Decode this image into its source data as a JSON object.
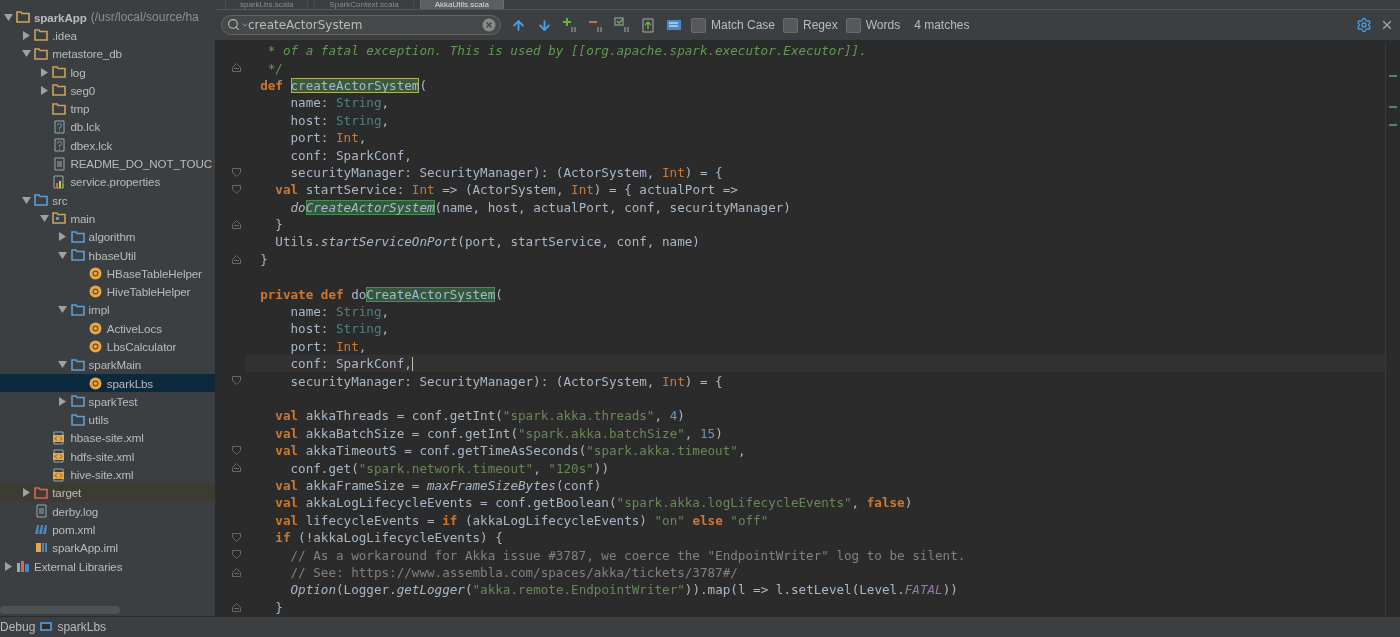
{
  "editor_tabs": [
    {
      "label": "sparkLbs.scala",
      "selected": false
    },
    {
      "label": "SparkContext.scala",
      "selected": false
    },
    {
      "label": "AkkaUtils.scala",
      "selected": true
    }
  ],
  "project_tree": [
    {
      "label": "sparkApp",
      "path": "(/usr/local/source/ha",
      "kind": "module",
      "expanded": true,
      "selected": false,
      "children": [
        {
          "label": ".idea",
          "kind": "folder",
          "expanded": false,
          "selected": false
        },
        {
          "label": "metastore_db",
          "kind": "folder",
          "expanded": true,
          "selected": false,
          "children": [
            {
              "label": "log",
              "kind": "folder",
              "expanded": false,
              "selected": false
            },
            {
              "label": "seg0",
              "kind": "folder",
              "expanded": false,
              "selected": false
            },
            {
              "label": "tmp",
              "kind": "folder",
              "selected": false
            },
            {
              "label": "db.lck",
              "kind": "unknown",
              "selected": false
            },
            {
              "label": "dbex.lck",
              "kind": "unknown",
              "selected": false
            },
            {
              "label": "README_DO_NOT_TOUC",
              "kind": "text",
              "selected": false
            },
            {
              "label": "service.properties",
              "kind": "properties",
              "selected": false
            }
          ]
        },
        {
          "label": "src",
          "kind": "source",
          "expanded": true,
          "selected": false,
          "children": [
            {
              "label": "main",
              "kind": "package",
              "expanded": true,
              "selected": false,
              "children": [
                {
                  "label": "algorithm",
                  "kind": "source",
                  "expanded": false,
                  "selected": false
                },
                {
                  "label": "hbaseUtil",
                  "kind": "source",
                  "expanded": true,
                  "selected": false,
                  "children": [
                    {
                      "label": "HBaseTableHelper",
                      "kind": "object",
                      "selected": false
                    },
                    {
                      "label": "HiveTableHelper",
                      "kind": "object",
                      "selected": false
                    }
                  ]
                },
                {
                  "label": "impl",
                  "kind": "source",
                  "expanded": true,
                  "selected": false,
                  "children": [
                    {
                      "label": "ActiveLocs",
                      "kind": "object",
                      "selected": false
                    },
                    {
                      "label": "LbsCalculator",
                      "kind": "object",
                      "selected": false
                    }
                  ]
                },
                {
                  "label": "sparkMain",
                  "kind": "source",
                  "expanded": true,
                  "selected": false,
                  "children": [
                    {
                      "label": "sparkLbs",
                      "kind": "object",
                      "selected": true
                    }
                  ]
                },
                {
                  "label": "sparkTest",
                  "kind": "source",
                  "expanded": false,
                  "selected": false
                },
                {
                  "label": "utils",
                  "kind": "source",
                  "selected": false
                }
              ]
            },
            {
              "label": "hbase-site.xml",
              "kind": "xml",
              "selected": false
            },
            {
              "label": "hdfs-site.xml",
              "kind": "xml",
              "selected": false
            },
            {
              "label": "hive-site.xml",
              "kind": "xml",
              "selected": false
            }
          ]
        },
        {
          "label": "target",
          "kind": "excluded",
          "expanded": false,
          "selected": false
        },
        {
          "label": "derby.log",
          "kind": "text",
          "selected": false
        },
        {
          "label": "pom.xml",
          "kind": "maven",
          "selected": false
        },
        {
          "label": "sparkApp.iml",
          "kind": "iml",
          "selected": false
        }
      ]
    },
    {
      "label": "External Libraries",
      "kind": "libraries",
      "expanded": false,
      "selected": false
    }
  ],
  "search_bar": {
    "value": "createActorSystem",
    "options": [
      {
        "label": "Match Case",
        "checked": false
      },
      {
        "label": "Regex",
        "checked": false
      },
      {
        "label": "Words",
        "checked": false
      }
    ],
    "result": "4 matches"
  },
  "code_lines": [
    {
      "kind": "plain",
      "current": false,
      "segments": [
        {
          "kind": "doc",
          "t": "   * of a fatal exception. This is used by [[org.apache.spark.executor.Executor]]."
        }
      ]
    },
    {
      "kind": "fold-end",
      "current": false,
      "segments": [
        {
          "kind": "doc",
          "t": "   */"
        }
      ]
    },
    {
      "kind": "plain",
      "current": false,
      "segments": [
        {
          "kind": "kw",
          "t": "  def "
        },
        {
          "kind": "current-match",
          "t": "createActorSystem"
        },
        {
          "kind": "plain",
          "t": "("
        }
      ]
    },
    {
      "kind": "plain",
      "current": false,
      "segments": [
        {
          "kind": "plain",
          "t": "      name: "
        },
        {
          "kind": "type",
          "t": "String"
        },
        {
          "kind": "plain",
          "t": ","
        }
      ]
    },
    {
      "kind": "plain",
      "current": false,
      "segments": [
        {
          "kind": "plain",
          "t": "      host: "
        },
        {
          "kind": "type",
          "t": "String"
        },
        {
          "kind": "plain",
          "t": ","
        }
      ]
    },
    {
      "kind": "plain",
      "current": false,
      "segments": [
        {
          "kind": "plain",
          "t": "      port: "
        },
        {
          "kind": "int",
          "t": "Int"
        },
        {
          "kind": "plain",
          "t": ","
        }
      ]
    },
    {
      "kind": "plain",
      "current": false,
      "segments": [
        {
          "kind": "plain",
          "t": "      conf: SparkConf,"
        }
      ]
    },
    {
      "kind": "fold-start",
      "current": false,
      "segments": [
        {
          "kind": "plain",
          "t": "      securityManager: SecurityManager): (ActorSystem, "
        },
        {
          "kind": "int",
          "t": "Int"
        },
        {
          "kind": "plain",
          "t": ") = {"
        }
      ]
    },
    {
      "kind": "fold-start",
      "current": false,
      "segments": [
        {
          "kind": "kw",
          "t": "    val "
        },
        {
          "kind": "plain",
          "t": "startService: "
        },
        {
          "kind": "int",
          "t": "Int"
        },
        {
          "kind": "plain",
          "t": " => (ActorSystem, "
        },
        {
          "kind": "int",
          "t": "Int"
        },
        {
          "kind": "plain",
          "t": ") = { actualPort =>"
        }
      ]
    },
    {
      "kind": "plain",
      "current": false,
      "segments": [
        {
          "kind": "italic",
          "t": "      do"
        },
        {
          "kind": "match-italic",
          "t": "CreateActorSystem"
        },
        {
          "kind": "plain",
          "t": "(name, host, actualPort, conf, securityManager)"
        }
      ]
    },
    {
      "kind": "fold-end",
      "current": false,
      "segments": [
        {
          "kind": "plain",
          "t": "    }"
        }
      ]
    },
    {
      "kind": "plain",
      "current": false,
      "segments": [
        {
          "kind": "plain",
          "t": "    Utils."
        },
        {
          "kind": "italic",
          "t": "startServiceOnPort"
        },
        {
          "kind": "plain",
          "t": "(port, startService, conf, name)"
        }
      ]
    },
    {
      "kind": "fold-end",
      "current": false,
      "segments": [
        {
          "kind": "plain",
          "t": "  }"
        }
      ]
    },
    {
      "kind": "blank"
    },
    {
      "kind": "plain",
      "current": false,
      "segments": [
        {
          "kind": "kw",
          "t": "  private def "
        },
        {
          "kind": "plain",
          "t": "do"
        },
        {
          "kind": "match",
          "t": "CreateActorSystem"
        },
        {
          "kind": "plain",
          "t": "("
        }
      ]
    },
    {
      "kind": "plain",
      "current": false,
      "segments": [
        {
          "kind": "plain",
          "t": "      name: "
        },
        {
          "kind": "type",
          "t": "String"
        },
        {
          "kind": "plain",
          "t": ","
        }
      ]
    },
    {
      "kind": "plain",
      "current": false,
      "segments": [
        {
          "kind": "plain",
          "t": "      host: "
        },
        {
          "kind": "type",
          "t": "String"
        },
        {
          "kind": "plain",
          "t": ","
        }
      ]
    },
    {
      "kind": "plain",
      "current": false,
      "segments": [
        {
          "kind": "plain",
          "t": "      port: "
        },
        {
          "kind": "int",
          "t": "Int"
        },
        {
          "kind": "plain",
          "t": ","
        }
      ]
    },
    {
      "kind": "plain",
      "current": true,
      "segments": [
        {
          "kind": "plain",
          "t": "      conf: SparkConf,"
        }
      ]
    },
    {
      "kind": "fold-start",
      "current": false,
      "segments": [
        {
          "kind": "plain",
          "t": "      securityManager: SecurityManager): (ActorSystem, "
        },
        {
          "kind": "int",
          "t": "Int"
        },
        {
          "kind": "plain",
          "t": ") = {"
        }
      ]
    },
    {
      "kind": "blank"
    },
    {
      "kind": "plain",
      "current": false,
      "segments": [
        {
          "kind": "kw",
          "t": "    val "
        },
        {
          "kind": "plain",
          "t": "akkaThreads = conf.getInt("
        },
        {
          "kind": "str",
          "t": "\"spark.akka.threads\""
        },
        {
          "kind": "plain",
          "t": ", "
        },
        {
          "kind": "num",
          "t": "4"
        },
        {
          "kind": "plain",
          "t": ")"
        }
      ]
    },
    {
      "kind": "plain",
      "current": false,
      "segments": [
        {
          "kind": "kw",
          "t": "    val "
        },
        {
          "kind": "plain",
          "t": "akkaBatchSize = conf.getInt("
        },
        {
          "kind": "str",
          "t": "\"spark.akka.batchSize\""
        },
        {
          "kind": "plain",
          "t": ", "
        },
        {
          "kind": "num",
          "t": "15"
        },
        {
          "kind": "plain",
          "t": ")"
        }
      ]
    },
    {
      "kind": "fold-start",
      "current": false,
      "segments": [
        {
          "kind": "kw",
          "t": "    val "
        },
        {
          "kind": "plain",
          "t": "akkaTimeoutS = conf.getTimeAsSeconds("
        },
        {
          "kind": "str",
          "t": "\"spark.akka.timeout\""
        },
        {
          "kind": "plain",
          "t": ","
        }
      ]
    },
    {
      "kind": "fold-end",
      "current": false,
      "segments": [
        {
          "kind": "plain",
          "t": "      conf.get("
        },
        {
          "kind": "str",
          "t": "\"spark.network.timeout\""
        },
        {
          "kind": "plain",
          "t": ", "
        },
        {
          "kind": "str",
          "t": "\"120s\""
        },
        {
          "kind": "plain",
          "t": "))"
        }
      ]
    },
    {
      "kind": "plain",
      "current": false,
      "segments": [
        {
          "kind": "kw",
          "t": "    val "
        },
        {
          "kind": "plain",
          "t": "akkaFrameSize = "
        },
        {
          "kind": "italic",
          "t": "maxFrameSizeBytes"
        },
        {
          "kind": "plain",
          "t": "(conf)"
        }
      ]
    },
    {
      "kind": "plain",
      "current": false,
      "segments": [
        {
          "kind": "kw",
          "t": "    val "
        },
        {
          "kind": "plain",
          "t": "akkaLogLifecycleEvents = conf.getBoolean("
        },
        {
          "kind": "str",
          "t": "\"spark.akka.logLifecycleEvents\""
        },
        {
          "kind": "plain",
          "t": ", "
        },
        {
          "kind": "kw",
          "t": "false"
        },
        {
          "kind": "plain",
          "t": ")"
        }
      ]
    },
    {
      "kind": "plain",
      "current": false,
      "segments": [
        {
          "kind": "kw",
          "t": "    val "
        },
        {
          "kind": "plain",
          "t": "lifecycleEvents = "
        },
        {
          "kind": "kw",
          "t": "if "
        },
        {
          "kind": "plain",
          "t": "(akkaLogLifecycleEvents) "
        },
        {
          "kind": "str",
          "t": "\"on\""
        },
        {
          "kind": "kw",
          "t": " else "
        },
        {
          "kind": "str",
          "t": "\"off\""
        }
      ]
    },
    {
      "kind": "fold-start",
      "current": false,
      "segments": [
        {
          "kind": "kw",
          "t": "    if "
        },
        {
          "kind": "plain",
          "t": "(!akkaLogLifecycleEvents) {"
        }
      ]
    },
    {
      "kind": "fold-start",
      "current": false,
      "segments": [
        {
          "kind": "comment",
          "t": "      // As a workaround for Akka issue #3787, we coerce the \"EndpointWriter\" log to be silent."
        }
      ]
    },
    {
      "kind": "fold-end",
      "current": false,
      "segments": [
        {
          "kind": "comment",
          "t": "      // See: https://www.assembla.com/spaces/akka/tickets/3787#/"
        }
      ]
    },
    {
      "kind": "plain",
      "current": false,
      "segments": [
        {
          "kind": "italic",
          "t": "      Option"
        },
        {
          "kind": "plain",
          "t": "(Logger."
        },
        {
          "kind": "italic",
          "t": "getLogger"
        },
        {
          "kind": "plain",
          "t": "("
        },
        {
          "kind": "str",
          "t": "\"akka.remote.EndpointWriter\""
        },
        {
          "kind": "plain",
          "t": ")).map(l => l.setLevel(Level."
        },
        {
          "kind": "const",
          "t": "FATAL"
        },
        {
          "kind": "plain",
          "t": "))"
        }
      ]
    },
    {
      "kind": "fold-end",
      "current": false,
      "segments": [
        {
          "kind": "plain",
          "t": "    }"
        }
      ]
    }
  ],
  "status_bar": {
    "tool": "Debug",
    "config": "sparkLbs"
  }
}
